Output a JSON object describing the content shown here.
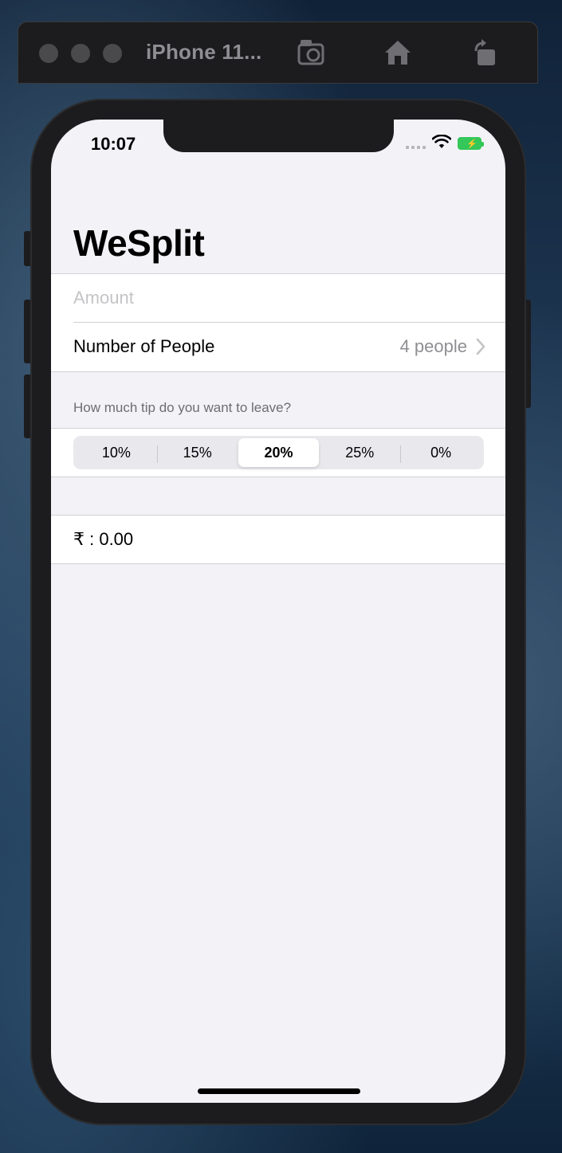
{
  "simulator": {
    "title": "iPhone 11...",
    "screenshot_icon": "camera-screenshot-icon",
    "home_icon": "home-icon",
    "rotate_icon": "rotate-icon"
  },
  "status_bar": {
    "time": "10:07",
    "wifi_icon": "wifi-icon",
    "battery_icon": "battery-charging-icon",
    "battery_color": "#34c759"
  },
  "nav": {
    "title": "WeSplit"
  },
  "form": {
    "amount_placeholder": "Amount",
    "amount_value": "",
    "people_label": "Number of People",
    "people_value": "4 people",
    "tip_header": "How much tip do you want to leave?",
    "tip_options": [
      "10%",
      "15%",
      "20%",
      "25%",
      "0%"
    ],
    "tip_selected": "20%",
    "result": "₹ : 0.00"
  },
  "colors": {
    "background": "#f2f2f7",
    "secondary_text": "#8e8e93",
    "placeholder": "#c4c4c7"
  }
}
